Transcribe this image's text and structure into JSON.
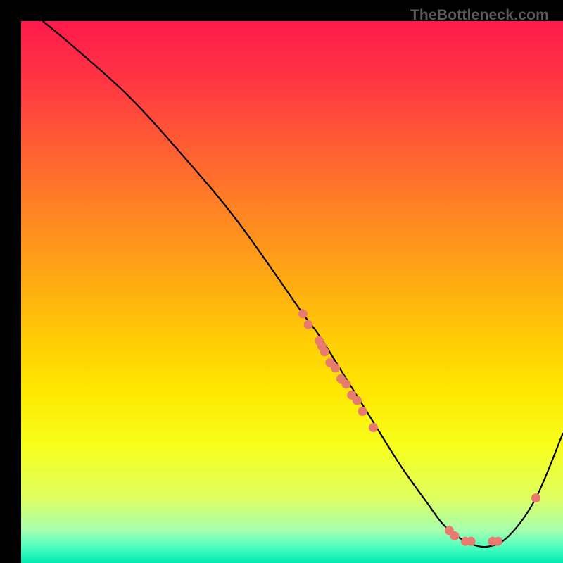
{
  "watermark": "TheBottleneck.com",
  "chart_data": {
    "type": "line",
    "title": "",
    "xlabel": "",
    "ylabel": "",
    "xlim": [
      0,
      100
    ],
    "ylim": [
      0,
      100
    ],
    "curve": {
      "name": "bottleneck-curve",
      "x": [
        4,
        10,
        20,
        30,
        40,
        52,
        55,
        60,
        65,
        70,
        75,
        78,
        82,
        86,
        90,
        95,
        100
      ],
      "y": [
        100,
        95,
        86,
        75,
        63,
        46,
        42,
        34,
        26,
        18,
        11,
        7,
        4,
        3,
        5,
        12,
        24
      ]
    },
    "scatter_points": {
      "name": "highlighted-points",
      "color": "#e87a6f",
      "points": [
        {
          "x": 52,
          "y": 46
        },
        {
          "x": 53,
          "y": 44
        },
        {
          "x": 55,
          "y": 41
        },
        {
          "x": 55.5,
          "y": 40
        },
        {
          "x": 56,
          "y": 39
        },
        {
          "x": 57,
          "y": 37
        },
        {
          "x": 58,
          "y": 36
        },
        {
          "x": 59,
          "y": 34
        },
        {
          "x": 60,
          "y": 33
        },
        {
          "x": 61,
          "y": 31
        },
        {
          "x": 62,
          "y": 30
        },
        {
          "x": 63,
          "y": 28
        },
        {
          "x": 65,
          "y": 25
        },
        {
          "x": 79,
          "y": 6
        },
        {
          "x": 80,
          "y": 5
        },
        {
          "x": 82,
          "y": 4
        },
        {
          "x": 83,
          "y": 4
        },
        {
          "x": 87,
          "y": 4
        },
        {
          "x": 88,
          "y": 4
        },
        {
          "x": 95,
          "y": 12
        }
      ]
    },
    "gradient_bands": [
      {
        "offset": 0.0,
        "color": "#ff1a4b"
      },
      {
        "offset": 0.1,
        "color": "#ff3244"
      },
      {
        "offset": 0.22,
        "color": "#ff5a34"
      },
      {
        "offset": 0.35,
        "color": "#ff8324"
      },
      {
        "offset": 0.48,
        "color": "#ffaa12"
      },
      {
        "offset": 0.58,
        "color": "#ffca06"
      },
      {
        "offset": 0.68,
        "color": "#ffe600"
      },
      {
        "offset": 0.78,
        "color": "#f8ff1a"
      },
      {
        "offset": 0.88,
        "color": "#deff60"
      },
      {
        "offset": 0.94,
        "color": "#a6ffb0"
      },
      {
        "offset": 0.97,
        "color": "#4fffc0"
      },
      {
        "offset": 1.0,
        "color": "#00eab0"
      }
    ]
  }
}
